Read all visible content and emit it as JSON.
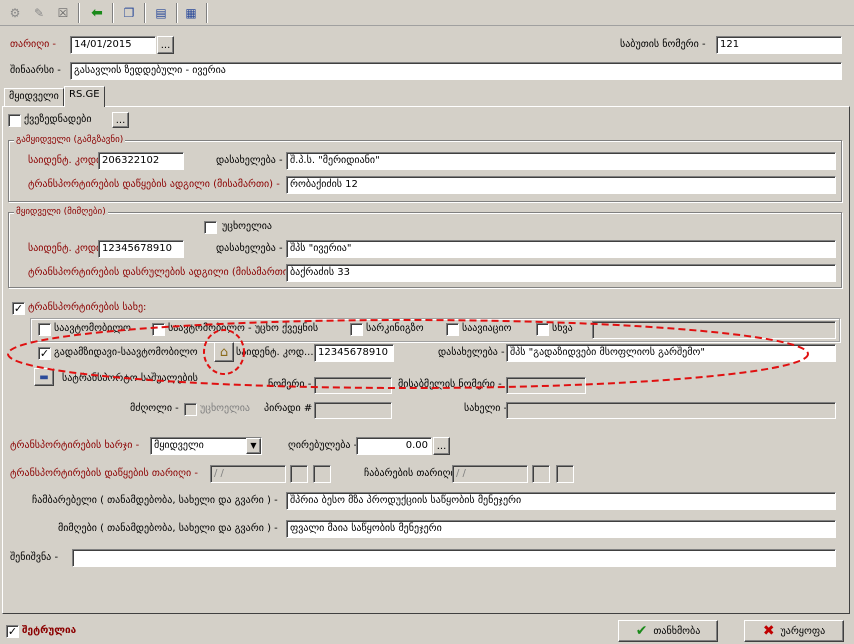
{
  "toolbar": {
    "icons": [
      "new-doc-icon",
      "open-doc-icon",
      "delete-icon",
      "back-arrow-icon",
      "copy-icon",
      "print-icon",
      "print-preview-icon"
    ]
  },
  "header": {
    "date_label": "თარიღი -",
    "date_value": "14/01/2015",
    "doc_number_label": "საბუთის ნომერი -",
    "doc_number_value": "121",
    "comment_label": "შინაარსი -",
    "comment_value": "გასავლის ზედდებული - ივერია",
    "date_button": "..."
  },
  "tabs": [
    {
      "label": "მყიდველი"
    },
    {
      "label": "RS.GE"
    }
  ],
  "goods_row": {
    "label": "ქვეზედნადები",
    "button": "..."
  },
  "seller": {
    "group_title": "გამყიდველი (გამგზავნი)",
    "tax_code_label": "საიდენტ. კოდი -",
    "tax_code_value": "206322102",
    "name_label": "დასახელება -",
    "name_value": "შ.პ.ს. \"მერიდიანი\"",
    "address_label": "ტრანსპორტირების დაწყების ადგილი (მისამართი) -",
    "address_value": "რობაქიძის 12"
  },
  "buyer": {
    "group_title": "მყიდველი (მიმღები)",
    "foreign_label": "უცხოელია",
    "tax_code_label": "საიდენტ. კოდი -",
    "tax_code_value": "12345678910",
    "name_label": "დასახელება -",
    "name_value": "შპს \"ივერია\"",
    "address_label": "ტრანსპორტირების დასრულების ადგილი (მისამართი) -",
    "address_value": "ბაქრაძის 33"
  },
  "transport": {
    "type_label": "ტრანსპორტირების სახე:",
    "options": [
      "საავტომობილო",
      "საავტომობილო - უცხო ქვეყნის",
      "სარკინიგზო",
      "საავიაციო",
      "სხვა"
    ],
    "carrier_label": "გადამზიდავი-საავტომობილო",
    "carrier_tax_label": "საიდენტ. კოდ...",
    "carrier_tax_value": "12345678910",
    "carrier_name_label": "დასახელება -",
    "carrier_name_value": "შპს \"გადაზიდვები მსოფლიოს გარშემო\"",
    "vehicle_label": "სატრანსპორტო საშუალების",
    "number_label": "ნომერი -",
    "trailer_label": "მისაბმელის ნომერი -",
    "driver_label": "მძღოლი -",
    "driver_foreign_label": "უცხოელია",
    "personal_no_label": "პირადი # -",
    "name2_label": "სახელი -"
  },
  "shipment": {
    "cost_by_label": "ტრანსპორტირების ხარჯი -",
    "cost_by_value": "მყიდველი",
    "cost_label": "ღირებულება -",
    "cost_value": "0.00",
    "cost_button": "...",
    "start_date_label": "ტრანსპორტირების დაწყების თარიღი -",
    "start_date_value": "/   /",
    "delivery_date_label": "ჩაბარების თარიღი -",
    "delivery_date_value": "/   /",
    "handed_by_label": "ჩამბარებელი ( თანამდებობა, სახელი და გვარი ) -",
    "handed_by_value": "შპრია ბესო მზა პროდუქციის საწყობის მენეჯერი",
    "received_by_label": "მიმღები ( თანამდებობა, სახელი და გვარი ) -",
    "received_by_value": "ფვალი მაია საწყობის მენეჯერი",
    "note_label": "შენიშვნა -",
    "note_value": ""
  },
  "footer": {
    "saved_label": "შეტრულია",
    "ok_label": "თანხმობა",
    "cancel_label": "უარყოფა"
  },
  "colors": {
    "annotation": "#e01010",
    "label_red": "#8b0000",
    "ok_check": "#1a8a1a",
    "cancel_x": "#c00000"
  }
}
